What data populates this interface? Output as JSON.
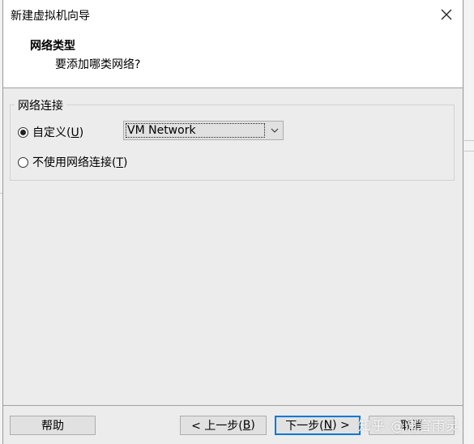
{
  "window": {
    "title": "新建虚拟机向导",
    "close_icon": "close-icon"
  },
  "header": {
    "section_title": "网络类型",
    "section_subtitle": "要添加哪类网络?"
  },
  "network_group": {
    "legend": "网络连接",
    "options": [
      {
        "label": "自定义(",
        "mnemonic": "U",
        "label_end": ")",
        "checked": true
      },
      {
        "label": "不使用网络连接(",
        "mnemonic": "T",
        "label_end": ")",
        "checked": false
      }
    ],
    "custom_network_select": {
      "selected": "VM Network",
      "arrow_icon": "chevron-down-icon"
    }
  },
  "footer": {
    "help_label": "帮助",
    "back_label": "< 上一步(",
    "back_mnemonic": "B",
    "back_end": ")",
    "next_label": "下一步(",
    "next_mnemonic": "N",
    "next_end": ") >",
    "cancel_label": "取消"
  },
  "watermark": "知乎 @浦官雨灵",
  "colors": {
    "dialog_bg": "#ececec",
    "header_bg": "#ffffff",
    "button_bg": "#e1e1e1",
    "primary_border": "#0078d7"
  }
}
